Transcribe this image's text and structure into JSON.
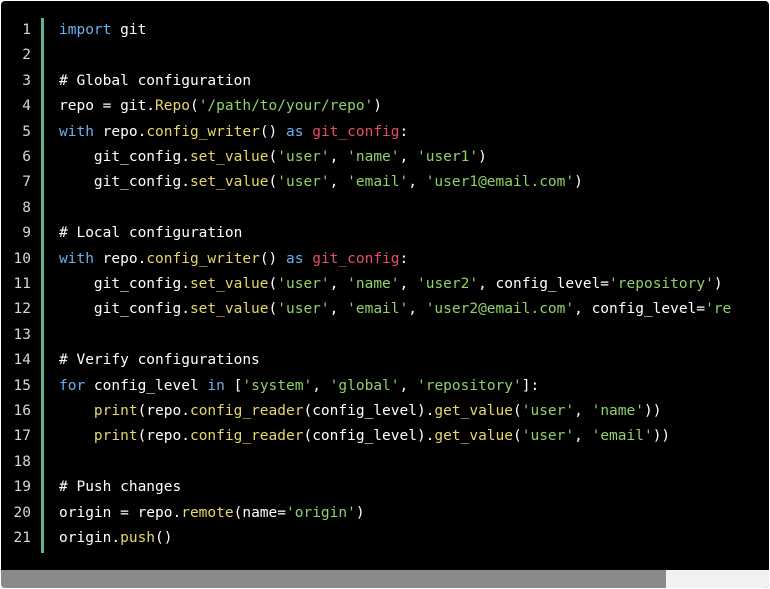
{
  "editor": {
    "line_numbers": [
      "1",
      "2",
      "3",
      "4",
      "5",
      "6",
      "7",
      "8",
      "9",
      "10",
      "11",
      "12",
      "13",
      "14",
      "15",
      "16",
      "17",
      "18",
      "19",
      "20",
      "21"
    ],
    "lines": [
      [
        {
          "t": "import",
          "c": "kw"
        },
        {
          "t": " git",
          "c": "pn"
        }
      ],
      [],
      [
        {
          "t": "# Global configuration",
          "c": "cm"
        }
      ],
      [
        {
          "t": "repo = git.",
          "c": "pn"
        },
        {
          "t": "Repo",
          "c": "fn"
        },
        {
          "t": "(",
          "c": "pn"
        },
        {
          "t": "'/path/to/your/repo'",
          "c": "st"
        },
        {
          "t": ")",
          "c": "pn"
        }
      ],
      [
        {
          "t": "with",
          "c": "kw"
        },
        {
          "t": " repo.",
          "c": "pn"
        },
        {
          "t": "config_writer",
          "c": "fn"
        },
        {
          "t": "() ",
          "c": "pn"
        },
        {
          "t": "as",
          "c": "kw"
        },
        {
          "t": " ",
          "c": "pn"
        },
        {
          "t": "git_config",
          "c": "var"
        },
        {
          "t": ":",
          "c": "pn"
        }
      ],
      [
        {
          "t": "    git_config.",
          "c": "pn"
        },
        {
          "t": "set_value",
          "c": "fn"
        },
        {
          "t": "(",
          "c": "pn"
        },
        {
          "t": "'user'",
          "c": "st"
        },
        {
          "t": ", ",
          "c": "pn"
        },
        {
          "t": "'name'",
          "c": "st"
        },
        {
          "t": ", ",
          "c": "pn"
        },
        {
          "t": "'user1'",
          "c": "st"
        },
        {
          "t": ")",
          "c": "pn"
        }
      ],
      [
        {
          "t": "    git_config.",
          "c": "pn"
        },
        {
          "t": "set_value",
          "c": "fn"
        },
        {
          "t": "(",
          "c": "pn"
        },
        {
          "t": "'user'",
          "c": "st"
        },
        {
          "t": ", ",
          "c": "pn"
        },
        {
          "t": "'email'",
          "c": "st"
        },
        {
          "t": ", ",
          "c": "pn"
        },
        {
          "t": "'user1@email.com'",
          "c": "st"
        },
        {
          "t": ")",
          "c": "pn"
        }
      ],
      [],
      [
        {
          "t": "# Local configuration",
          "c": "cm"
        }
      ],
      [
        {
          "t": "with",
          "c": "kw"
        },
        {
          "t": " repo.",
          "c": "pn"
        },
        {
          "t": "config_writer",
          "c": "fn"
        },
        {
          "t": "() ",
          "c": "pn"
        },
        {
          "t": "as",
          "c": "kw"
        },
        {
          "t": " ",
          "c": "pn"
        },
        {
          "t": "git_config",
          "c": "var"
        },
        {
          "t": ":",
          "c": "pn"
        }
      ],
      [
        {
          "t": "    git_config.",
          "c": "pn"
        },
        {
          "t": "set_value",
          "c": "fn"
        },
        {
          "t": "(",
          "c": "pn"
        },
        {
          "t": "'user'",
          "c": "st"
        },
        {
          "t": ", ",
          "c": "pn"
        },
        {
          "t": "'name'",
          "c": "st"
        },
        {
          "t": ", ",
          "c": "pn"
        },
        {
          "t": "'user2'",
          "c": "st"
        },
        {
          "t": ", config_level=",
          "c": "pn"
        },
        {
          "t": "'repository'",
          "c": "st"
        },
        {
          "t": ")",
          "c": "pn"
        }
      ],
      [
        {
          "t": "    git_config.",
          "c": "pn"
        },
        {
          "t": "set_value",
          "c": "fn"
        },
        {
          "t": "(",
          "c": "pn"
        },
        {
          "t": "'user'",
          "c": "st"
        },
        {
          "t": ", ",
          "c": "pn"
        },
        {
          "t": "'email'",
          "c": "st"
        },
        {
          "t": ", ",
          "c": "pn"
        },
        {
          "t": "'user2@email.com'",
          "c": "st"
        },
        {
          "t": ", config_level=",
          "c": "pn"
        },
        {
          "t": "'re",
          "c": "st"
        }
      ],
      [],
      [
        {
          "t": "# Verify configurations",
          "c": "cm"
        }
      ],
      [
        {
          "t": "for",
          "c": "kw"
        },
        {
          "t": " config_level ",
          "c": "pn"
        },
        {
          "t": "in",
          "c": "kw"
        },
        {
          "t": " [",
          "c": "pn"
        },
        {
          "t": "'system'",
          "c": "st"
        },
        {
          "t": ", ",
          "c": "pn"
        },
        {
          "t": "'global'",
          "c": "st"
        },
        {
          "t": ", ",
          "c": "pn"
        },
        {
          "t": "'repository'",
          "c": "st"
        },
        {
          "t": "]:",
          "c": "pn"
        }
      ],
      [
        {
          "t": "    ",
          "c": "pn"
        },
        {
          "t": "print",
          "c": "fn"
        },
        {
          "t": "(repo.",
          "c": "pn"
        },
        {
          "t": "config_reader",
          "c": "fn"
        },
        {
          "t": "(config_level).",
          "c": "pn"
        },
        {
          "t": "get_value",
          "c": "fn"
        },
        {
          "t": "(",
          "c": "pn"
        },
        {
          "t": "'user'",
          "c": "st"
        },
        {
          "t": ", ",
          "c": "pn"
        },
        {
          "t": "'name'",
          "c": "st"
        },
        {
          "t": "))",
          "c": "pn"
        }
      ],
      [
        {
          "t": "    ",
          "c": "pn"
        },
        {
          "t": "print",
          "c": "fn"
        },
        {
          "t": "(repo.",
          "c": "pn"
        },
        {
          "t": "config_reader",
          "c": "fn"
        },
        {
          "t": "(config_level).",
          "c": "pn"
        },
        {
          "t": "get_value",
          "c": "fn"
        },
        {
          "t": "(",
          "c": "pn"
        },
        {
          "t": "'user'",
          "c": "st"
        },
        {
          "t": ", ",
          "c": "pn"
        },
        {
          "t": "'email'",
          "c": "st"
        },
        {
          "t": "))",
          "c": "pn"
        }
      ],
      [],
      [
        {
          "t": "# Push changes",
          "c": "cm"
        }
      ],
      [
        {
          "t": "origin = repo.",
          "c": "pn"
        },
        {
          "t": "remote",
          "c": "fn"
        },
        {
          "t": "(name=",
          "c": "pn"
        },
        {
          "t": "'origin'",
          "c": "st"
        },
        {
          "t": ")",
          "c": "pn"
        }
      ],
      [
        {
          "t": "origin.",
          "c": "pn"
        },
        {
          "t": "push",
          "c": "fn"
        },
        {
          "t": "()",
          "c": "pn"
        }
      ]
    ]
  },
  "scrollbar": {
    "position": 0.0,
    "visible_fraction": 0.865
  }
}
